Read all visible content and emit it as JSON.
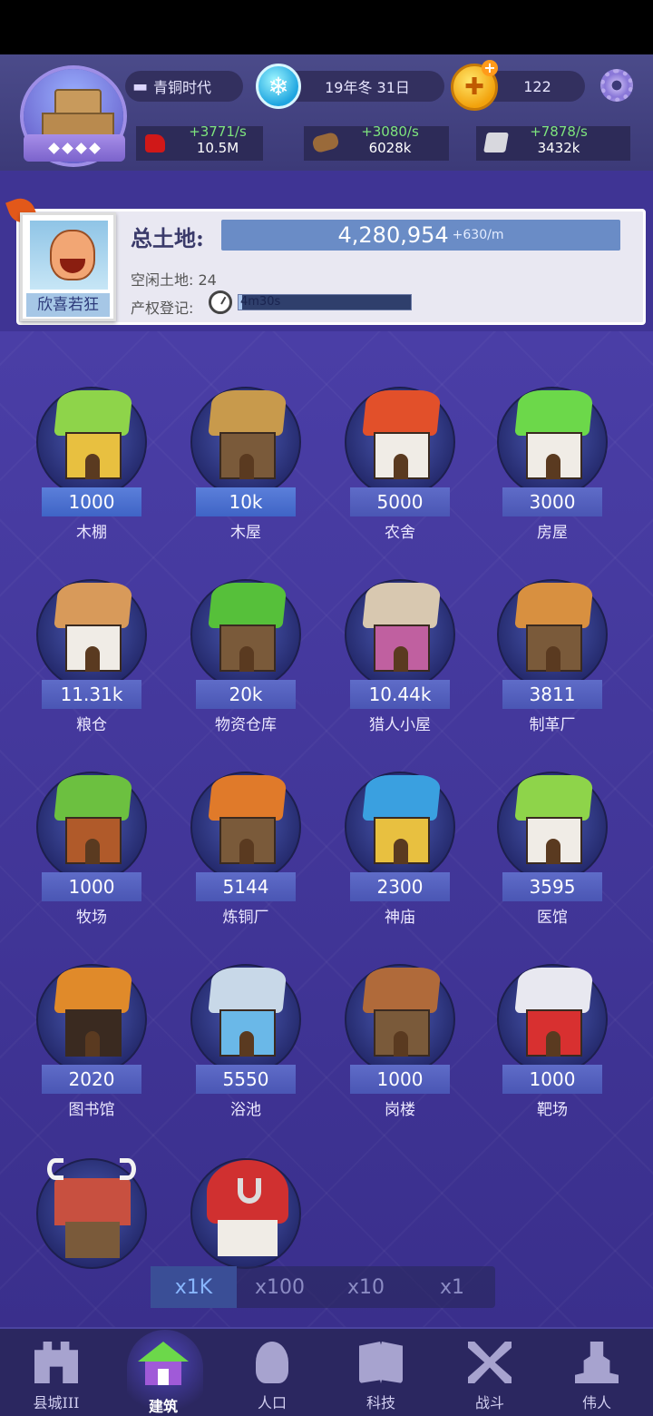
{
  "header": {
    "age": "青铜时代",
    "date": "19年冬 31日",
    "gold": "122"
  },
  "resources": [
    {
      "name": "food",
      "rate": "+3771/s",
      "amount": "10.5M"
    },
    {
      "name": "wood",
      "rate": "+3080/s",
      "amount": "6028k"
    },
    {
      "name": "stone",
      "rate": "+7878/s",
      "amount": "3432k"
    }
  ],
  "land": {
    "leader_name": "欣喜若狂",
    "title": "总土地:",
    "total": "4,280,954",
    "rate": "+630/m",
    "idle": "空闲土地: 24",
    "property_label": "产权登记:",
    "timer": "4m30s",
    "timer_progress": 0.02
  },
  "buildings": [
    {
      "name": "木棚",
      "count": "1000",
      "unlocked": true
    },
    {
      "name": "木屋",
      "count": "10k",
      "unlocked": true
    },
    {
      "name": "农舍",
      "count": "5000"
    },
    {
      "name": "房屋",
      "count": "3000"
    },
    {
      "name": "粮仓",
      "count": "11.31k"
    },
    {
      "name": "物资仓库",
      "count": "20k"
    },
    {
      "name": "猎人小屋",
      "count": "10.44k"
    },
    {
      "name": "制革厂",
      "count": "3811"
    },
    {
      "name": "牧场",
      "count": "1000"
    },
    {
      "name": "炼铜厂",
      "count": "5144"
    },
    {
      "name": "神庙",
      "count": "2300"
    },
    {
      "name": "医馆",
      "count": "3595"
    },
    {
      "name": "图书馆",
      "count": "2020"
    },
    {
      "name": "浴池",
      "count": "5550"
    },
    {
      "name": "岗楼",
      "count": "1000"
    },
    {
      "name": "靶场",
      "count": "1000"
    }
  ],
  "multipliers": [
    "x1K",
    "x100",
    "x10",
    "x1"
  ],
  "nav": [
    {
      "label": "县城III",
      "icon": "castle-icon"
    },
    {
      "label": "建筑",
      "icon": "house-icon"
    },
    {
      "label": "人口",
      "icon": "person-icon"
    },
    {
      "label": "科技",
      "icon": "book-icon"
    },
    {
      "label": "战斗",
      "icon": "swords-icon"
    },
    {
      "label": "伟人",
      "icon": "statue-icon"
    }
  ],
  "colors": {
    "accent": "#6a8cc6",
    "rate_green": "#7ee47e",
    "background": "#3f3494"
  }
}
